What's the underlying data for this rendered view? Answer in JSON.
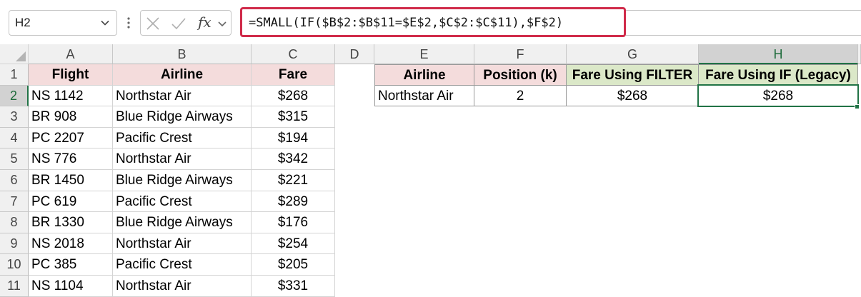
{
  "name_box": {
    "value": "H2"
  },
  "formula_bar": {
    "formula": "=SMALL(IF($B$2:$B$11=$E$2,$C$2:$C$11),$F$2)",
    "fx_label": "fx"
  },
  "columns": [
    "A",
    "B",
    "C",
    "D",
    "E",
    "F",
    "G",
    "H"
  ],
  "rows": [
    "1",
    "2",
    "3",
    "4",
    "5",
    "6",
    "7",
    "8",
    "9",
    "10",
    "11"
  ],
  "table1": {
    "headers": [
      "Flight",
      "Airline",
      "Fare"
    ],
    "rows": [
      [
        "NS 1142",
        "Northstar Air",
        "$268"
      ],
      [
        "BR 908",
        "Blue Ridge Airways",
        "$315"
      ],
      [
        "PC 2207",
        "Pacific Crest",
        "$194"
      ],
      [
        "NS 776",
        "Northstar Air",
        "$342"
      ],
      [
        "BR 1450",
        "Blue Ridge Airways",
        "$221"
      ],
      [
        "PC 619",
        "Pacific Crest",
        "$289"
      ],
      [
        "BR 1330",
        "Blue Ridge Airways",
        "$176"
      ],
      [
        "NS 2018",
        "Northstar Air",
        "$254"
      ],
      [
        "PC 385",
        "Pacific Crest",
        "$205"
      ],
      [
        "NS 1104",
        "Northstar Air",
        "$331"
      ]
    ]
  },
  "table2": {
    "headers": [
      "Airline",
      "Position (k)",
      "Fare Using FILTER",
      "Fare Using IF (Legacy)"
    ],
    "row": [
      "Northstar Air",
      "2",
      "$268",
      "$268"
    ]
  },
  "selection": {
    "active_cell": "H2"
  },
  "colors": {
    "accent": "#217346",
    "formula_border": "#d02b4a",
    "header_pink": "#f4dcdc",
    "header_green": "#dbe8c8"
  }
}
